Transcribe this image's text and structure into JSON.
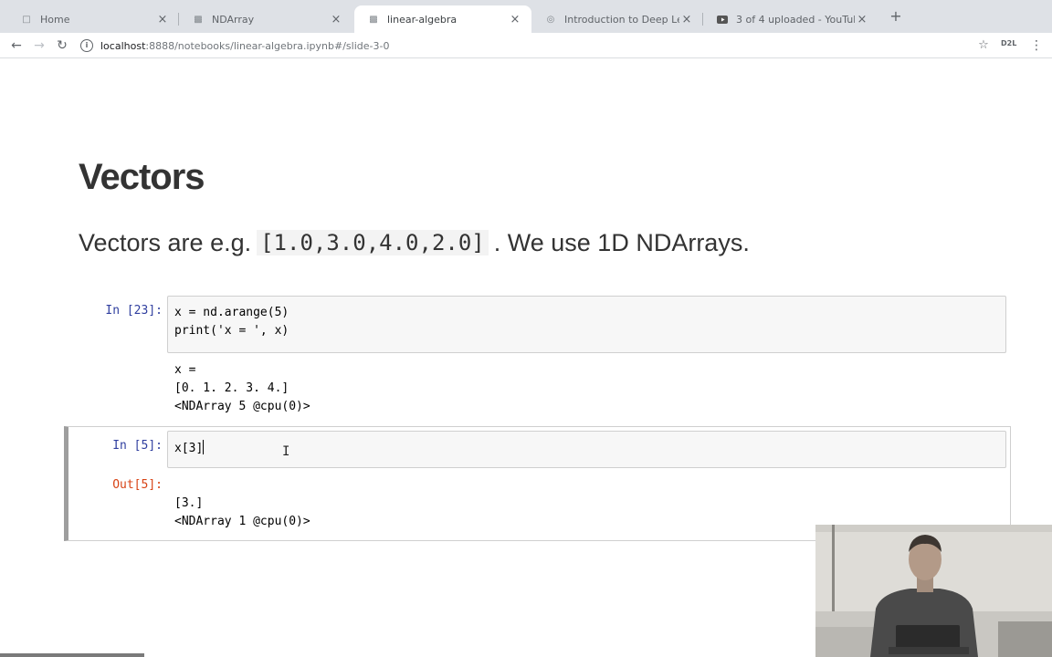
{
  "browser": {
    "tabs": [
      {
        "title": "Home",
        "icon": "page-icon",
        "active": false
      },
      {
        "title": "NDArray",
        "icon": "notebook-icon",
        "active": false
      },
      {
        "title": "linear-algebra",
        "icon": "notebook-icon",
        "active": true
      },
      {
        "title": "Introduction to Deep Learning",
        "icon": "globe-icon",
        "active": false
      },
      {
        "title": "3 of 4 uploaded - YouTube",
        "icon": "youtube-icon",
        "active": false
      }
    ],
    "url_host": "localhost",
    "url_path": ":8888/notebooks/linear-algebra.ipynb#/slide-3-0",
    "extension_label": "D2L"
  },
  "slide": {
    "title": "Vectors",
    "lead_prefix": "Vectors are e.g.",
    "lead_code": "[1.0,3.0,4.0,2.0]",
    "lead_suffix": ". We use 1D NDArrays."
  },
  "cells": [
    {
      "prompt": "In [23]:",
      "code": "x = nd.arange(5)\nprint('x = ', x)",
      "output_prompt": "",
      "output": "x = \n[0. 1. 2. 3. 4.]\n<NDArray 5 @cpu(0)>"
    },
    {
      "prompt": "In [5]:",
      "code": "x[3]",
      "output_prompt": "Out[5]:",
      "output": "[3.]\n<NDArray 1 @cpu(0)>"
    }
  ],
  "colors": {
    "prompt_in": "#303f9f",
    "prompt_out": "#d84315",
    "cell_bg": "#f7f7f7",
    "tab_strip": "#dee1e6"
  }
}
